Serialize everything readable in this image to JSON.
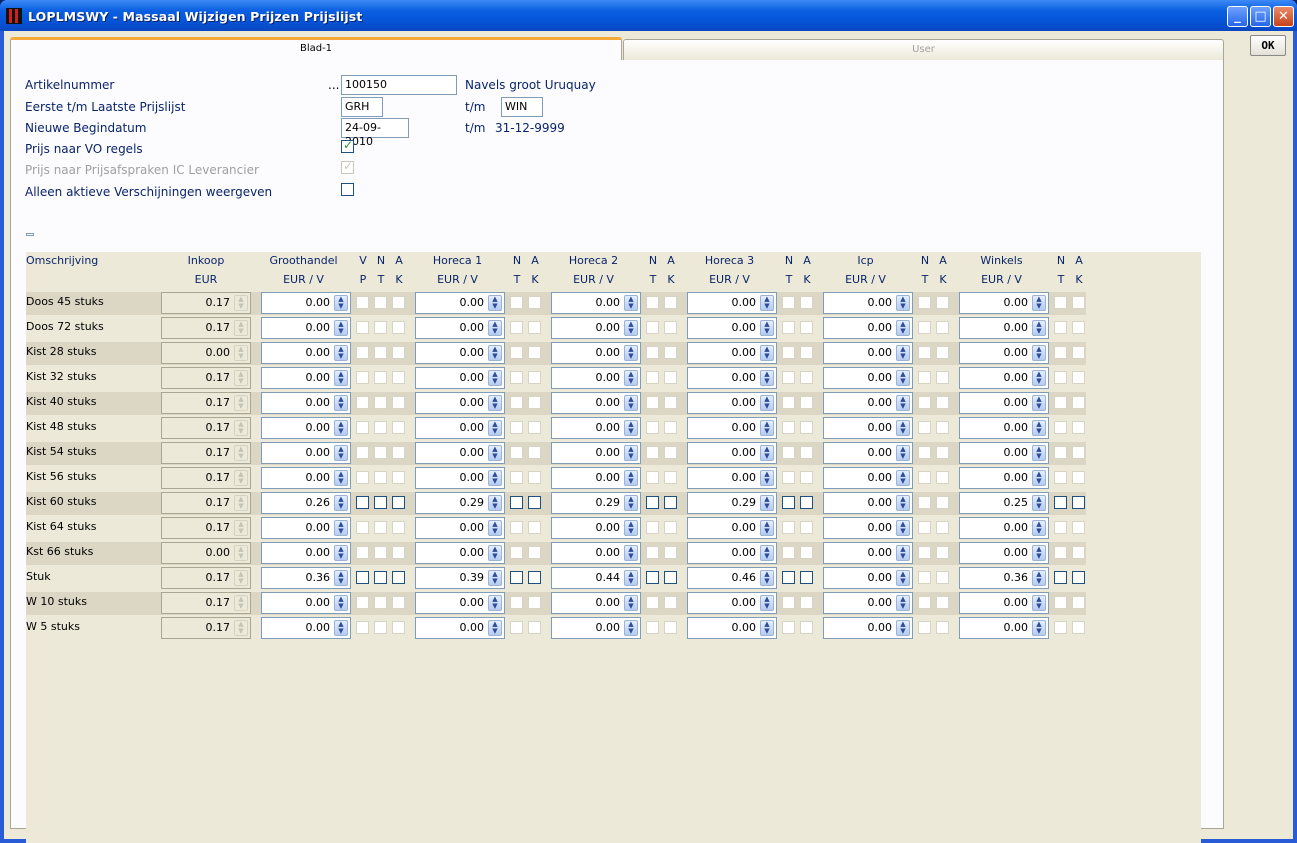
{
  "window": {
    "title": "LOPLMSWY - Massaal Wijzigen Prijzen Prijslijst",
    "minimize": "_",
    "maximize": "□",
    "close": "✕"
  },
  "tabs": [
    {
      "label": "Blad-1"
    },
    {
      "label": "User"
    }
  ],
  "ok_label": "OK",
  "form": {
    "artikelnummer_label": "Artikelnummer",
    "artikel_ellipsis": "...",
    "artikelnummer": "100150",
    "artikel_desc": "Navels groot Uruquay",
    "prijslijst_label": "Eerste t/m Laatste Prijslijst",
    "prijslijst_from": "GRH",
    "tm": "t/m",
    "prijslijst_to": "WIN",
    "begindatum_label": "Nieuwe Begindatum",
    "begindatum": "24-09-2010",
    "einddatum": "31-12-9999",
    "vo_label": "Prijs naar VO regels",
    "vo_checked": true,
    "ic_label": "Prijs naar Prijsafspraken IC Leverancier",
    "ic_checked": true,
    "aktief_label": "Alleen aktieve Verschijningen weergeven",
    "aktief_checked": false
  },
  "columns": {
    "omschrijving": "Omschrijving",
    "inkoop": {
      "top": "Inkoop",
      "sub": "EUR"
    },
    "groups": [
      {
        "name": "Groothandel",
        "sub": "EUR / V",
        "flags_top": [
          "V",
          "N",
          "A"
        ],
        "flags_sub": [
          "P",
          "T",
          "K"
        ]
      },
      {
        "name": "Horeca 1",
        "sub": "EUR / V",
        "flags_top": [
          "N",
          "A"
        ],
        "flags_sub": [
          "T",
          "K"
        ]
      },
      {
        "name": "Horeca 2",
        "sub": "EUR / V",
        "flags_top": [
          "N",
          "A"
        ],
        "flags_sub": [
          "T",
          "K"
        ]
      },
      {
        "name": "Horeca 3",
        "sub": "EUR / V",
        "flags_top": [
          "N",
          "A"
        ],
        "flags_sub": [
          "T",
          "K"
        ]
      },
      {
        "name": "Icp",
        "sub": "EUR / V",
        "flags_top": [
          "N",
          "A"
        ],
        "flags_sub": [
          "T",
          "K"
        ]
      },
      {
        "name": "Winkels",
        "sub": "EUR / V",
        "flags_top": [
          "N",
          "A"
        ],
        "flags_sub": [
          "T",
          "K"
        ]
      }
    ]
  },
  "rows": [
    {
      "desc": "Doos 45 stuks",
      "inkoop": "0.17",
      "prices": [
        "0.00",
        "0.00",
        "0.00",
        "0.00",
        "0.00",
        "0.00"
      ]
    },
    {
      "desc": "Doos 72 stuks",
      "inkoop": "0.17",
      "prices": [
        "0.00",
        "0.00",
        "0.00",
        "0.00",
        "0.00",
        "0.00"
      ]
    },
    {
      "desc": "Kist 28 stuks",
      "inkoop": "0.00",
      "prices": [
        "0.00",
        "0.00",
        "0.00",
        "0.00",
        "0.00",
        "0.00"
      ]
    },
    {
      "desc": "Kist 32 stuks",
      "inkoop": "0.17",
      "prices": [
        "0.00",
        "0.00",
        "0.00",
        "0.00",
        "0.00",
        "0.00"
      ]
    },
    {
      "desc": "Kist 40 stuks",
      "inkoop": "0.17",
      "prices": [
        "0.00",
        "0.00",
        "0.00",
        "0.00",
        "0.00",
        "0.00"
      ]
    },
    {
      "desc": "Kist 48 stuks",
      "inkoop": "0.17",
      "prices": [
        "0.00",
        "0.00",
        "0.00",
        "0.00",
        "0.00",
        "0.00"
      ]
    },
    {
      "desc": "Kist 54 stuks",
      "inkoop": "0.17",
      "prices": [
        "0.00",
        "0.00",
        "0.00",
        "0.00",
        "0.00",
        "0.00"
      ]
    },
    {
      "desc": "Kist 56 stuks",
      "inkoop": "0.17",
      "prices": [
        "0.00",
        "0.00",
        "0.00",
        "0.00",
        "0.00",
        "0.00"
      ]
    },
    {
      "desc": "Kist 60 stuks",
      "inkoop": "0.17",
      "prices": [
        "0.26",
        "0.29",
        "0.29",
        "0.29",
        "0.00",
        "0.25"
      ],
      "active": [
        true,
        true,
        true,
        true,
        false,
        true
      ]
    },
    {
      "desc": "Kist 64 stuks",
      "inkoop": "0.17",
      "prices": [
        "0.00",
        "0.00",
        "0.00",
        "0.00",
        "0.00",
        "0.00"
      ]
    },
    {
      "desc": "Kst 66 stuks",
      "inkoop": "0.00",
      "prices": [
        "0.00",
        "0.00",
        "0.00",
        "0.00",
        "0.00",
        "0.00"
      ]
    },
    {
      "desc": "Stuk",
      "inkoop": "0.17",
      "prices": [
        "0.36",
        "0.39",
        "0.44",
        "0.46",
        "0.00",
        "0.36"
      ],
      "active": [
        true,
        true,
        true,
        true,
        false,
        true
      ]
    },
    {
      "desc": "W 10 stuks",
      "inkoop": "0.17",
      "prices": [
        "0.00",
        "0.00",
        "0.00",
        "0.00",
        "0.00",
        "0.00"
      ]
    },
    {
      "desc": "W 5 stuks",
      "inkoop": "0.17",
      "prices": [
        "0.00",
        "0.00",
        "0.00",
        "0.00",
        "0.00",
        "0.00"
      ]
    }
  ]
}
